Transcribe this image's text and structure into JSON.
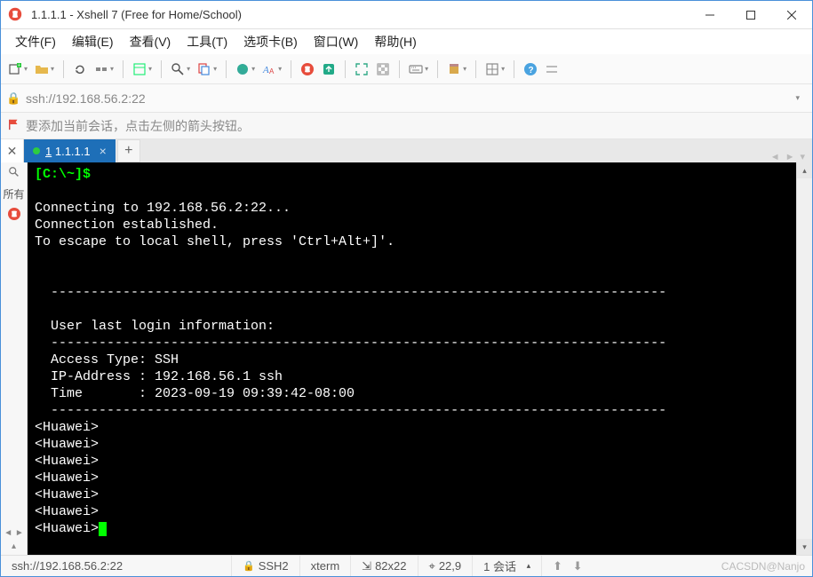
{
  "window": {
    "title": "1.1.1.1 - Xshell 7 (Free for Home/School)"
  },
  "menubar": [
    "文件(F)",
    "编辑(E)",
    "查看(V)",
    "工具(T)",
    "选项卡(B)",
    "窗口(W)",
    "帮助(H)"
  ],
  "address": {
    "url": "ssh://192.168.56.2:22"
  },
  "infobar": {
    "message": "要添加当前会话，点击左侧的箭头按钮。"
  },
  "tabs": {
    "active": {
      "num": "1",
      "label": "1.1.1.1"
    }
  },
  "left_gutter": {
    "label": "所有"
  },
  "terminal": {
    "prompt": "[C:\\~]$",
    "lines": [
      "",
      "Connecting to 192.168.56.2:22...",
      "Connection established.",
      "To escape to local shell, press 'Ctrl+Alt+]'.",
      "",
      "",
      "  -----------------------------------------------------------------------------",
      "",
      "  User last login information:",
      "  -----------------------------------------------------------------------------",
      "  Access Type: SSH",
      "  IP-Address : 192.168.56.1 ssh",
      "  Time       : 2023-09-19 09:39:42-08:00",
      "  -----------------------------------------------------------------------------",
      "<Huawei>",
      "<Huawei>",
      "<Huawei>",
      "<Huawei>",
      "<Huawei>",
      "<Huawei>"
    ],
    "current_prompt": "<Huawei>"
  },
  "statusbar": {
    "conn": "ssh://192.168.56.2:22",
    "proto": "SSH2",
    "term": "xterm",
    "size": "82x22",
    "pos": "22,9",
    "sessions": "1 会话",
    "watermark": "CACSDN@Nanjo"
  }
}
